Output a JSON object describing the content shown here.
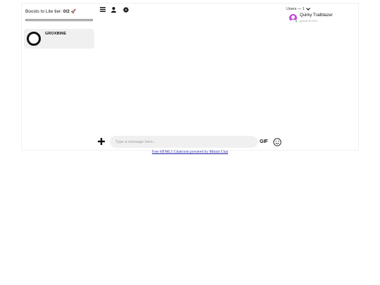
{
  "boosts": {
    "label": "Boosts to Lite tier:",
    "count": "0/2",
    "icon": "rocket-icon",
    "progress": 0
  },
  "channels": [
    {
      "name": "GROXBINE",
      "icon": "ring-logo-icon"
    }
  ],
  "toolbar": {
    "menu_icon": "hamburger-menu-icon",
    "user_icon": "user-icon",
    "settings_icon": "gear-icon"
  },
  "users": {
    "header": "Users — 1",
    "list": [
      {
        "name": "Quirky Trailblazer",
        "id": "guest7427474",
        "status": "online"
      }
    ]
  },
  "composer": {
    "placeholder": "Type a message here...",
    "gif_label": "GIF",
    "add_icon": "plus-icon",
    "emoji_icon": "smiley-icon"
  },
  "footer": {
    "link_text": "Free HTML5 Chatroom powered by Minnit Chat"
  },
  "colors": {
    "avatar": "#c04bd6",
    "online": "#36b14e",
    "link": "#1a1aa6",
    "card_bg": "#f0f0f0"
  }
}
